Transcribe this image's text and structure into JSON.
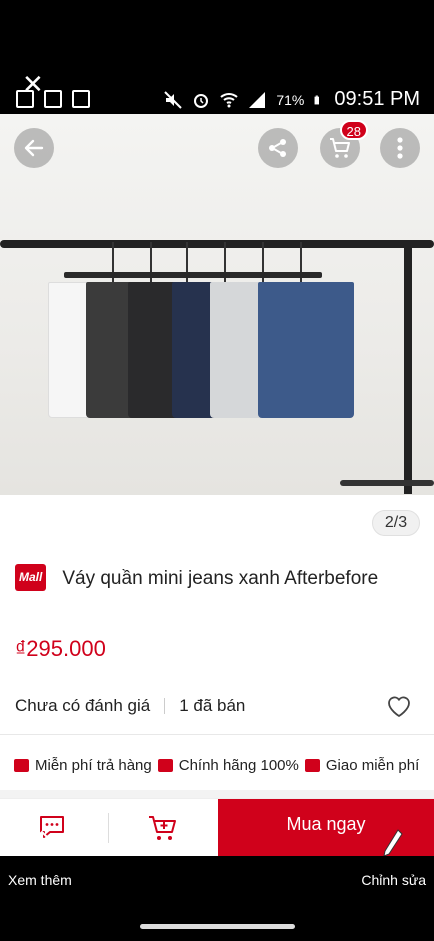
{
  "status_bar": {
    "battery_percent": "71%",
    "time": "09:51 PM"
  },
  "header": {
    "cart_count": "28"
  },
  "gallery": {
    "page_indicator": "2/3"
  },
  "product": {
    "mall_badge": "Mall",
    "title": "Váy quần mini jeans xanh Afterbefore",
    "price": "₫295.000",
    "rating_text": "Chưa có đánh giá",
    "sold_text": "1 đã bán"
  },
  "benefits": [
    {
      "label": "Miễn phí trả hàng",
      "icon": "return-icon"
    },
    {
      "label": "Chính hãng 100%",
      "icon": "shield-check-icon"
    },
    {
      "label": "Giao miễn phí",
      "icon": "truck-icon"
    }
  ],
  "action_bar": {
    "buy_label": "Mua ngay"
  },
  "system_bar": {
    "left_label": "Xem thêm",
    "right_label": "Chỉnh sửa"
  },
  "colors": {
    "accent": "#d0011b",
    "status_bg": "#000000"
  }
}
